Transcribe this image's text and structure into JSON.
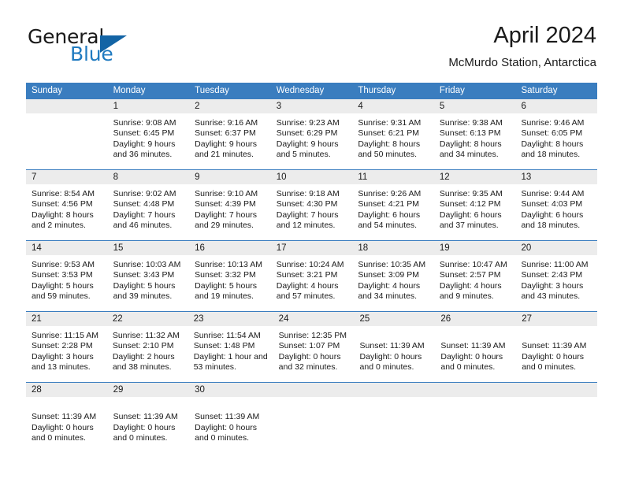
{
  "brand": {
    "name_top": "General",
    "name_bottom": "Blue",
    "accent_color": "#1f7ac0",
    "triangle_color": "#1364a5"
  },
  "header": {
    "title": "April 2024",
    "subtitle": "McMurdo Station, Antarctica"
  },
  "theme": {
    "header_row_bg": "#3a7dbf",
    "daynum_bg": "#ececec",
    "text_color": "#1a1a1a"
  },
  "weekdays": [
    "Sunday",
    "Monday",
    "Tuesday",
    "Wednesday",
    "Thursday",
    "Friday",
    "Saturday"
  ],
  "weeks": [
    [
      {
        "day": "",
        "lines": []
      },
      {
        "day": "1",
        "lines": [
          "Sunrise: 9:08 AM",
          "Sunset: 6:45 PM",
          "Daylight: 9 hours",
          "and 36 minutes."
        ]
      },
      {
        "day": "2",
        "lines": [
          "Sunrise: 9:16 AM",
          "Sunset: 6:37 PM",
          "Daylight: 9 hours",
          "and 21 minutes."
        ]
      },
      {
        "day": "3",
        "lines": [
          "Sunrise: 9:23 AM",
          "Sunset: 6:29 PM",
          "Daylight: 9 hours",
          "and 5 minutes."
        ]
      },
      {
        "day": "4",
        "lines": [
          "Sunrise: 9:31 AM",
          "Sunset: 6:21 PM",
          "Daylight: 8 hours",
          "and 50 minutes."
        ]
      },
      {
        "day": "5",
        "lines": [
          "Sunrise: 9:38 AM",
          "Sunset: 6:13 PM",
          "Daylight: 8 hours",
          "and 34 minutes."
        ]
      },
      {
        "day": "6",
        "lines": [
          "Sunrise: 9:46 AM",
          "Sunset: 6:05 PM",
          "Daylight: 8 hours",
          "and 18 minutes."
        ]
      }
    ],
    [
      {
        "day": "7",
        "lines": [
          "Sunrise: 8:54 AM",
          "Sunset: 4:56 PM",
          "Daylight: 8 hours",
          "and 2 minutes."
        ]
      },
      {
        "day": "8",
        "lines": [
          "Sunrise: 9:02 AM",
          "Sunset: 4:48 PM",
          "Daylight: 7 hours",
          "and 46 minutes."
        ]
      },
      {
        "day": "9",
        "lines": [
          "Sunrise: 9:10 AM",
          "Sunset: 4:39 PM",
          "Daylight: 7 hours",
          "and 29 minutes."
        ]
      },
      {
        "day": "10",
        "lines": [
          "Sunrise: 9:18 AM",
          "Sunset: 4:30 PM",
          "Daylight: 7 hours",
          "and 12 minutes."
        ]
      },
      {
        "day": "11",
        "lines": [
          "Sunrise: 9:26 AM",
          "Sunset: 4:21 PM",
          "Daylight: 6 hours",
          "and 54 minutes."
        ]
      },
      {
        "day": "12",
        "lines": [
          "Sunrise: 9:35 AM",
          "Sunset: 4:12 PM",
          "Daylight: 6 hours",
          "and 37 minutes."
        ]
      },
      {
        "day": "13",
        "lines": [
          "Sunrise: 9:44 AM",
          "Sunset: 4:03 PM",
          "Daylight: 6 hours",
          "and 18 minutes."
        ]
      }
    ],
    [
      {
        "day": "14",
        "lines": [
          "Sunrise: 9:53 AM",
          "Sunset: 3:53 PM",
          "Daylight: 5 hours",
          "and 59 minutes."
        ]
      },
      {
        "day": "15",
        "lines": [
          "Sunrise: 10:03 AM",
          "Sunset: 3:43 PM",
          "Daylight: 5 hours",
          "and 39 minutes."
        ]
      },
      {
        "day": "16",
        "lines": [
          "Sunrise: 10:13 AM",
          "Sunset: 3:32 PM",
          "Daylight: 5 hours",
          "and 19 minutes."
        ]
      },
      {
        "day": "17",
        "lines": [
          "Sunrise: 10:24 AM",
          "Sunset: 3:21 PM",
          "Daylight: 4 hours",
          "and 57 minutes."
        ]
      },
      {
        "day": "18",
        "lines": [
          "Sunrise: 10:35 AM",
          "Sunset: 3:09 PM",
          "Daylight: 4 hours",
          "and 34 minutes."
        ]
      },
      {
        "day": "19",
        "lines": [
          "Sunrise: 10:47 AM",
          "Sunset: 2:57 PM",
          "Daylight: 4 hours",
          "and 9 minutes."
        ]
      },
      {
        "day": "20",
        "lines": [
          "Sunrise: 11:00 AM",
          "Sunset: 2:43 PM",
          "Daylight: 3 hours",
          "and 43 minutes."
        ]
      }
    ],
    [
      {
        "day": "21",
        "lines": [
          "Sunrise: 11:15 AM",
          "Sunset: 2:28 PM",
          "Daylight: 3 hours",
          "and 13 minutes."
        ]
      },
      {
        "day": "22",
        "lines": [
          "Sunrise: 11:32 AM",
          "Sunset: 2:10 PM",
          "Daylight: 2 hours",
          "and 38 minutes."
        ]
      },
      {
        "day": "23",
        "lines": [
          "Sunrise: 11:54 AM",
          "Sunset: 1:48 PM",
          "Daylight: 1 hour and",
          "53 minutes."
        ]
      },
      {
        "day": "24",
        "lines": [
          "Sunrise: 12:35 PM",
          "Sunset: 1:07 PM",
          "Daylight: 0 hours",
          "and 32 minutes."
        ]
      },
      {
        "day": "25",
        "lines": [
          "",
          "Sunset: 11:39 AM",
          "Daylight: 0 hours",
          "and 0 minutes."
        ]
      },
      {
        "day": "26",
        "lines": [
          "",
          "Sunset: 11:39 AM",
          "Daylight: 0 hours",
          "and 0 minutes."
        ]
      },
      {
        "day": "27",
        "lines": [
          "",
          "Sunset: 11:39 AM",
          "Daylight: 0 hours",
          "and 0 minutes."
        ]
      }
    ],
    [
      {
        "day": "28",
        "lines": [
          "",
          "Sunset: 11:39 AM",
          "Daylight: 0 hours",
          "and 0 minutes."
        ]
      },
      {
        "day": "29",
        "lines": [
          "",
          "Sunset: 11:39 AM",
          "Daylight: 0 hours",
          "and 0 minutes."
        ]
      },
      {
        "day": "30",
        "lines": [
          "",
          "Sunset: 11:39 AM",
          "Daylight: 0 hours",
          "and 0 minutes."
        ]
      },
      {
        "day": "",
        "lines": []
      },
      {
        "day": "",
        "lines": []
      },
      {
        "day": "",
        "lines": []
      },
      {
        "day": "",
        "lines": []
      }
    ]
  ]
}
